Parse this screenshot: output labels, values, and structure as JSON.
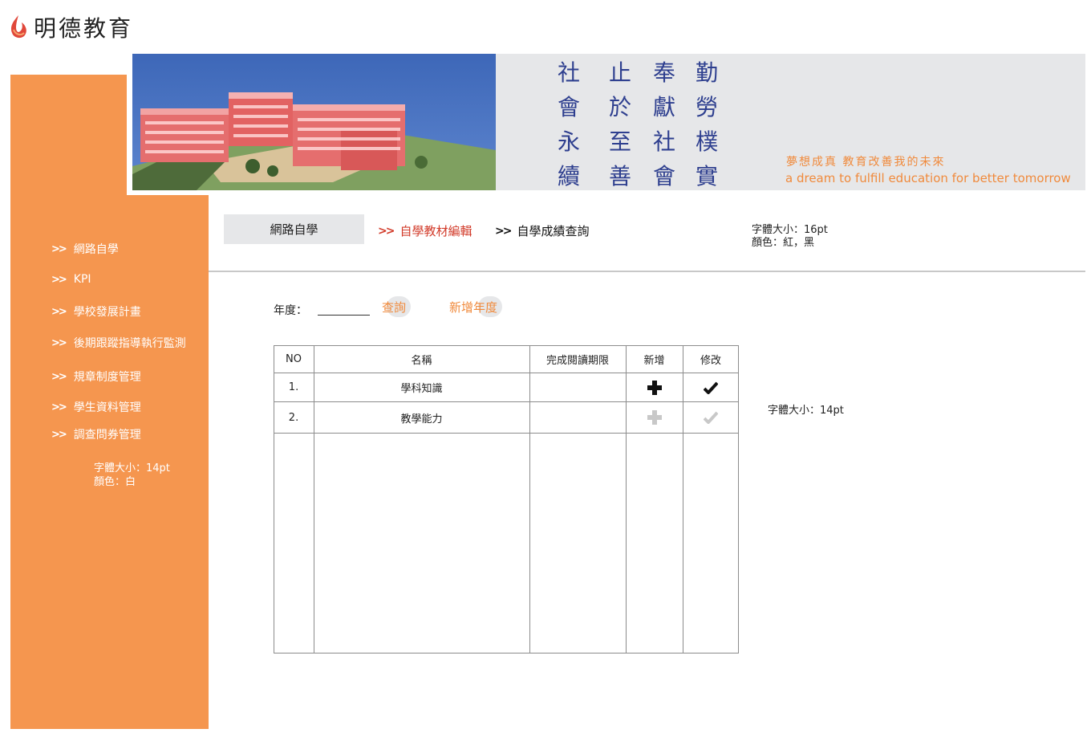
{
  "logo": {
    "text": "明德教育"
  },
  "banner": {
    "motto_columns": [
      "勤勞樸實",
      "奉獻社會",
      "止於至善",
      "社會永續"
    ],
    "slogan_zh": "夢想成真 教育改善我的未來",
    "slogan_en": "a dream to fulfill education for better tomorrow"
  },
  "sidebar": {
    "items": [
      {
        "label": "網路自學"
      },
      {
        "label": "KPI"
      },
      {
        "label": "學校發展計畫"
      },
      {
        "label": "後期跟蹤指導執行監測"
      },
      {
        "label": "規章制度管理"
      },
      {
        "label": "學生資料管理"
      },
      {
        "label": "調查問券管理"
      }
    ],
    "note_size": "字體大小：14pt",
    "note_color": "顏色：白"
  },
  "tabs": {
    "active": "網路自學",
    "edit": "自學教材編輯",
    "score": "自學成績查詢"
  },
  "notes": {
    "top_size": "字體大小：16pt",
    "top_color": "顏色：紅，黑",
    "table_size": "字體大小：14pt"
  },
  "filter": {
    "year_label": "年度：",
    "year_value": "",
    "query_label": "查詢",
    "add_year_label": "新增年度"
  },
  "table": {
    "headers": [
      "NO",
      "名稱",
      "完成閱讀期限",
      "新增",
      "修改"
    ],
    "rows": [
      {
        "no": "1.",
        "name": "學科知識",
        "deadline": "",
        "add_icon": "plus-icon",
        "edit_icon": "check-icon",
        "enabled": true
      },
      {
        "no": "2.",
        "name": "教學能力",
        "deadline": "",
        "add_icon": "plus-icon",
        "edit_icon": "check-icon",
        "enabled": false
      }
    ]
  },
  "colors": {
    "sidebar": "#F5964F",
    "accent_red": "#D23B2A",
    "accent_orange": "#F08A3C",
    "motto_blue": "#2E3F8F",
    "panel_gray": "#E6E7E9"
  }
}
